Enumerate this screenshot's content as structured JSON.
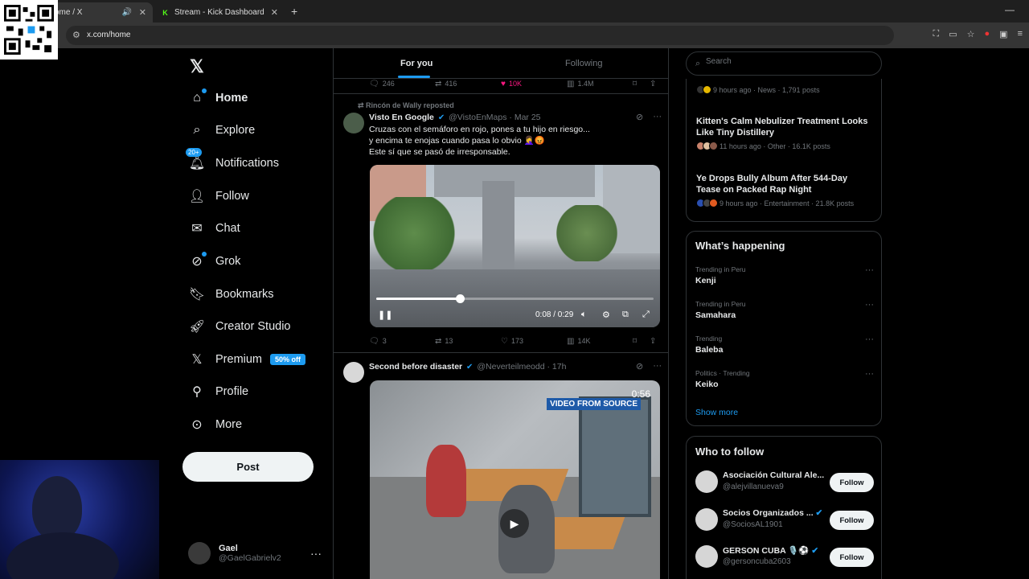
{
  "browser": {
    "tabs": [
      {
        "title": "ome / X",
        "favicon": "x-logo"
      },
      {
        "title": "Stream - Kick Dashboard",
        "favicon": "kick-logo"
      }
    ],
    "url": "x.com/home",
    "new_tab": "+",
    "minimize": "—"
  },
  "nav": {
    "logo": "𝕏",
    "items": [
      {
        "label": "Home",
        "icon": "home-icon"
      },
      {
        "label": "Explore",
        "icon": "search-icon"
      },
      {
        "label": "Notifications",
        "icon": "bell-icon",
        "badge": "20+"
      },
      {
        "label": "Follow",
        "icon": "add-person-icon"
      },
      {
        "label": "Chat",
        "icon": "mail-icon"
      },
      {
        "label": "Grok",
        "icon": "grok-icon"
      },
      {
        "label": "Bookmarks",
        "icon": "bookmark-icon"
      },
      {
        "label": "Creator Studio",
        "icon": "rocket-icon"
      },
      {
        "label": "Premium",
        "icon": "x-icon",
        "badge": "50% off"
      },
      {
        "label": "Profile",
        "icon": "person-icon"
      },
      {
        "label": "More",
        "icon": "more-circle-icon"
      }
    ],
    "post_button": "Post",
    "account": {
      "name": "Gael",
      "handle": "@GaelGabrielv2"
    }
  },
  "feed": {
    "tabs": [
      "For you",
      "Following"
    ],
    "prev_actions": {
      "replies": "246",
      "reposts": "416",
      "likes": "10K",
      "views": "1.4M"
    },
    "tweet1": {
      "repost_by": "Rincón de Wally reposted",
      "name": "Visto En Google",
      "handle": "@VistoEnMaps",
      "time": "· Mar 25",
      "text_lines": [
        "Cruzas con el semáforo en rojo, pones a tu hijo en riesgo...",
        "y encima te enojas cuando pasa lo obvio 🤦‍♀️😡",
        "Este sí que se pasó de irresponsable."
      ],
      "video_time": "0:08 / 0:29",
      "progress": 0.3,
      "actions": {
        "replies": "3",
        "reposts": "13",
        "likes": "173",
        "views": "14K"
      }
    },
    "tweet2": {
      "name": "Second before disaster",
      "handle": "@Neverteilmeodd",
      "time": "· 17h",
      "video_duration": "0:56",
      "video_tag": "VIDEO FROM SOURCE"
    }
  },
  "right": {
    "search_placeholder": "Search",
    "news": [
      {
        "title": "",
        "meta": "9 hours ago · News · 1,791 posts"
      },
      {
        "title": "Kitten's Calm Nebulizer Treatment Looks Like Tiny Distillery",
        "meta": "11 hours ago · Other · 16.1K posts"
      },
      {
        "title": "Ye Drops Bully Album After 544-Day Tease on Packed Rap Night",
        "meta": "9 hours ago · Entertainment · 21.8K posts"
      }
    ],
    "whats_happening": {
      "title": "What’s happening",
      "trends": [
        {
          "context": "Trending in Peru",
          "name": "Kenji"
        },
        {
          "context": "Trending in Peru",
          "name": "Samahara"
        },
        {
          "context": "Trending",
          "name": "Baleba"
        },
        {
          "context": "Politics · Trending",
          "name": "Keiko"
        }
      ],
      "show_more": "Show more"
    },
    "who_to_follow": {
      "title": "Who to follow",
      "users": [
        {
          "name": "Asociación Cultural Ale...",
          "handle": "@alejvillanueva9",
          "button": "Follow"
        },
        {
          "name": "Socios Organizados ...",
          "handle": "@SociosAL1901",
          "button": "Follow",
          "verified": true
        },
        {
          "name": "GERSON CUBA 🎙️⚽",
          "handle": "@gersoncuba2603",
          "button": "Follow",
          "verified": true
        }
      ]
    }
  },
  "colors": {
    "accent": "#1d9bf0",
    "like": "#f91880",
    "border": "#2f3336"
  }
}
